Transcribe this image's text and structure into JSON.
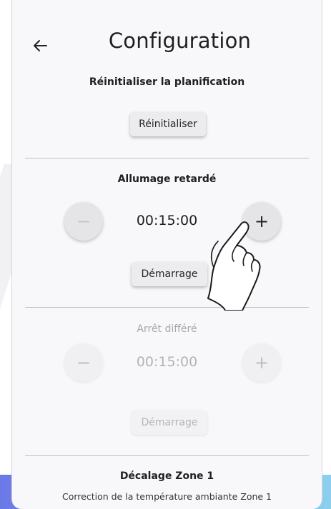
{
  "header": {
    "title": "Configuration",
    "back_icon": "arrow-left-icon"
  },
  "reset_section": {
    "title": "Réinitialiser la planification",
    "button_label": "Réinitialiser"
  },
  "delayed_start": {
    "title": "Allumage retardé",
    "minus_label": "−",
    "plus_label": "+",
    "time_value": "00:15:00",
    "start_button_label": "Démarrage"
  },
  "delayed_stop": {
    "title": "Arrêt différé",
    "minus_label": "−",
    "plus_label": "+",
    "time_value": "00:15:00",
    "start_button_label": "Démarrage",
    "enabled": false
  },
  "offset_zone1": {
    "title": "Décalage Zone 1",
    "subtitle": "Correction de la température ambiante Zone 1"
  },
  "overlay": {
    "hand_icon": "pointing-hand-icon"
  }
}
